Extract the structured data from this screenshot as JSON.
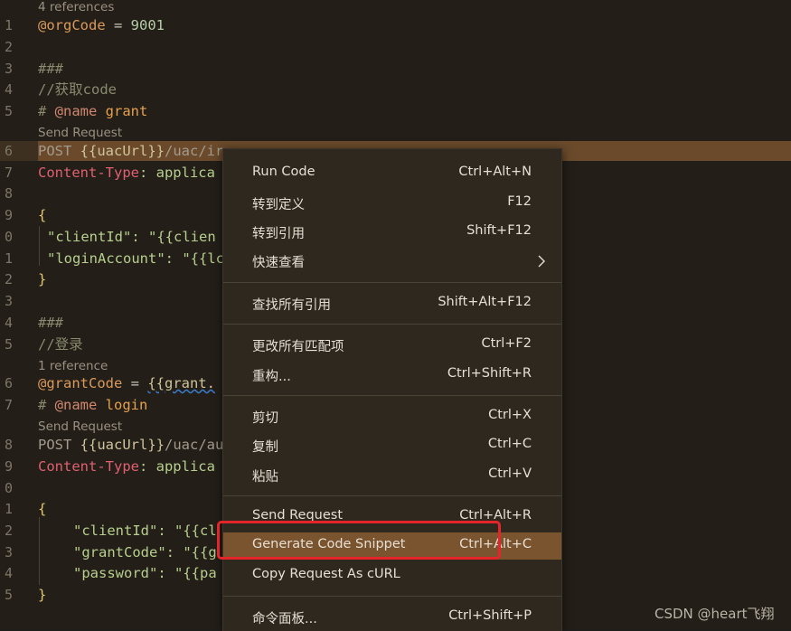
{
  "line_numbers": [
    "1",
    "2",
    "3",
    "4",
    "5",
    "6",
    "7",
    "8",
    "9",
    "0",
    "1",
    "2",
    "3",
    "4",
    "5",
    "6",
    "7",
    "8",
    "9",
    "0",
    "1",
    "2",
    "3",
    "4",
    "5"
  ],
  "lens": {
    "refs_top": "4 references",
    "send1": "Send Request",
    "refs_one": "1 reference",
    "send2": "Send Request"
  },
  "code": {
    "l1_var": "@orgCode",
    "l1_eq": " = ",
    "l1_val": "9001",
    "l3": "###",
    "l4": "//获取code",
    "l5_hash": "# ",
    "l5_at": "@name",
    "l5_name": " grant",
    "l6_post": "POST ",
    "l6_url": "{{uacUrl}}",
    "l6_path": "/uac/ir",
    "l7_header": "Content-Type",
    "l7_rest": ": applica",
    "l9": "{",
    "l10_key": "\"clientId\"",
    "l10_rest": ": \"{{clien",
    "l11_key": "\"loginAccount\"",
    "l11_rest": ": \"{{lc",
    "l12": "}",
    "l14": "###",
    "l15": "//登录",
    "l16_var": "@grantCode",
    "l16_eq": " = ",
    "l16_val": "{{grant.",
    "l17_hash": "# ",
    "l17_at": "@name",
    "l17_name": " login",
    "l18_post": "POST ",
    "l18_url": "{{uacUrl}}",
    "l18_path": "/uac/au",
    "l19_header": "Content-Type",
    "l19_rest": ": applica",
    "l21": "{",
    "l22_key": "\"clientId\"",
    "l22_rest": ": \"{{cl",
    "l23_key": "\"grantCode\"",
    "l23_rest": ": \"{{g",
    "l24_key": "\"password\"",
    "l24_rest": ": \"{{pa",
    "l25": "}"
  },
  "menu": {
    "items": [
      {
        "label": "Run Code",
        "shortcut": "Ctrl+Alt+N"
      },
      {
        "label": "转到定义",
        "shortcut": "F12"
      },
      {
        "label": "转到引用",
        "shortcut": "Shift+F12"
      },
      {
        "label": "快速查看",
        "shortcut": ""
      },
      {
        "label": "查找所有引用",
        "shortcut": "Shift+Alt+F12"
      },
      {
        "label": "更改所有匹配项",
        "shortcut": "Ctrl+F2"
      },
      {
        "label": "重构...",
        "shortcut": "Ctrl+Shift+R"
      },
      {
        "label": "剪切",
        "shortcut": "Ctrl+X"
      },
      {
        "label": "复制",
        "shortcut": "Ctrl+C"
      },
      {
        "label": "粘贴",
        "shortcut": "Ctrl+V"
      },
      {
        "label": "Send Request",
        "shortcut": "Ctrl+Alt+R"
      },
      {
        "label": "Generate Code Snippet",
        "shortcut": "Ctrl+Alt+C"
      },
      {
        "label": "Copy Request As cURL",
        "shortcut": ""
      },
      {
        "label": "命令面板...",
        "shortcut": "Ctrl+Shift+P"
      }
    ],
    "active_label": "Generate Code Snippet"
  },
  "watermark": "CSDN @heart飞翔",
  "colors": {
    "background": "#231e18",
    "selection": "#6a4a2b",
    "menu_background": "#2f281f",
    "menu_active": "#7a532f",
    "highlight_box": "#e4262b"
  }
}
